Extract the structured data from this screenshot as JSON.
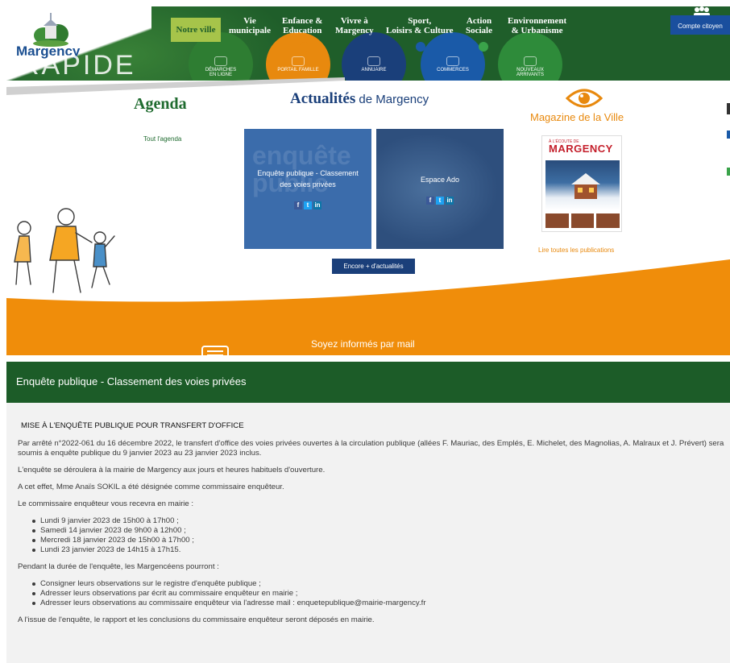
{
  "header": {
    "logo_text": "Margency",
    "rapide_text": "RAPIDE",
    "nav": {
      "notre_ville": "Notre ville",
      "vie_1": "Vie",
      "vie_2": "municipale",
      "enfance_1": "Enfance &",
      "enfance_2": "Education",
      "vivre_1": "Vivre à",
      "vivre_2": "Margency",
      "sport_1": "Sport,",
      "sport_2": "Loisirs & Culture",
      "action_1": "Action",
      "action_2": "Sociale",
      "env_1": "Environnement",
      "env_2": "& Urbanisme"
    },
    "quick_links": {
      "demarches_1": "DÉMARCHES",
      "demarches_2": "EN LIGNE",
      "portail": "PORTAIL FAMILLE",
      "annuaire": "ANNUAIRE",
      "commerces": "COMMERCES",
      "nouveaux_1": "NOUVEAUX",
      "nouveaux_2": "ARRIVANTS"
    },
    "compte_citoyen": "Compte citoyen",
    "colors": {
      "green": "#1f5e2a",
      "orange": "#e8890e",
      "blue": "#1a4f9e",
      "lime": "#a6c44a"
    }
  },
  "agenda": {
    "title": "Agenda",
    "link": "Tout l'agenda"
  },
  "actualites": {
    "title_bold": "Actualités",
    "title_rest": " de Margency",
    "cards": [
      {
        "bg_text_1": "enquête",
        "bg_text_2": "public",
        "title_1": "Enquête publique - Classement",
        "title_2": "des voies privées"
      },
      {
        "title_1": "Espace Ado"
      }
    ],
    "social": {
      "facebook": "f",
      "twitter": "t",
      "linkedin": "in"
    },
    "more_button": "Encore + d'actualités"
  },
  "magazine": {
    "title": "Magazine de la Ville",
    "cover_tag": "À L'ÉCOUTE DE",
    "cover_name": "MARGENCY",
    "link": "Lire toutes les publications"
  },
  "newsletter": {
    "text": "Soyez informés par mail"
  },
  "article": {
    "header_title": "Enquête publique - Classement des voies privées",
    "heading": "MISE À L'ENQUÊTE PUBLIQUE POUR TRANSFERT D'OFFICE",
    "p1": "Par arrêté n°2022-061 du 16 décembre 2022, le transfert d'office des voies privées ouvertes à la circulation publique (allées F. Mauriac, des Emplés, E. Michelet, des Magnolias, A. Malraux et J. Prévert) sera soumis à enquête publique du 9 janvier 2023 au 23 janvier 2023 inclus.",
    "p2": "L'enquête se déroulera à la mairie de Margency aux jours et heures habituels d'ouverture.",
    "p3": "A cet effet, Mme Anaïs SOKIL a été désignée comme commissaire enquêteur.",
    "p4": "Le commissaire enquêteur vous recevra en mairie :",
    "dates": [
      "Lundi 9 janvier 2023 de 15h00 à 17h00 ;",
      "Samedi 14 janvier 2023 de 9h00 à 12h00 ;",
      "Mercredi 18 janvier 2023 de 15h00 à 17h00 ;",
      "Lundi 23 janvier 2023 de 14h15 à 17h15."
    ],
    "p5": "Pendant la durée de l'enquête, les Margencéens pourront :",
    "actions": [
      "Consigner leurs observations sur le registre d'enquête publique ;",
      "Adresser leurs observations par écrit au commissaire enquêteur en mairie ;",
      "Adresser leurs observations au commissaire enquêteur via l'adresse mail : enquetepublique@mairie-margency.fr"
    ],
    "p6": "A l'issue de l'enquête, le rapport et les conclusions du commissaire enquêteur seront déposés en mairie."
  }
}
